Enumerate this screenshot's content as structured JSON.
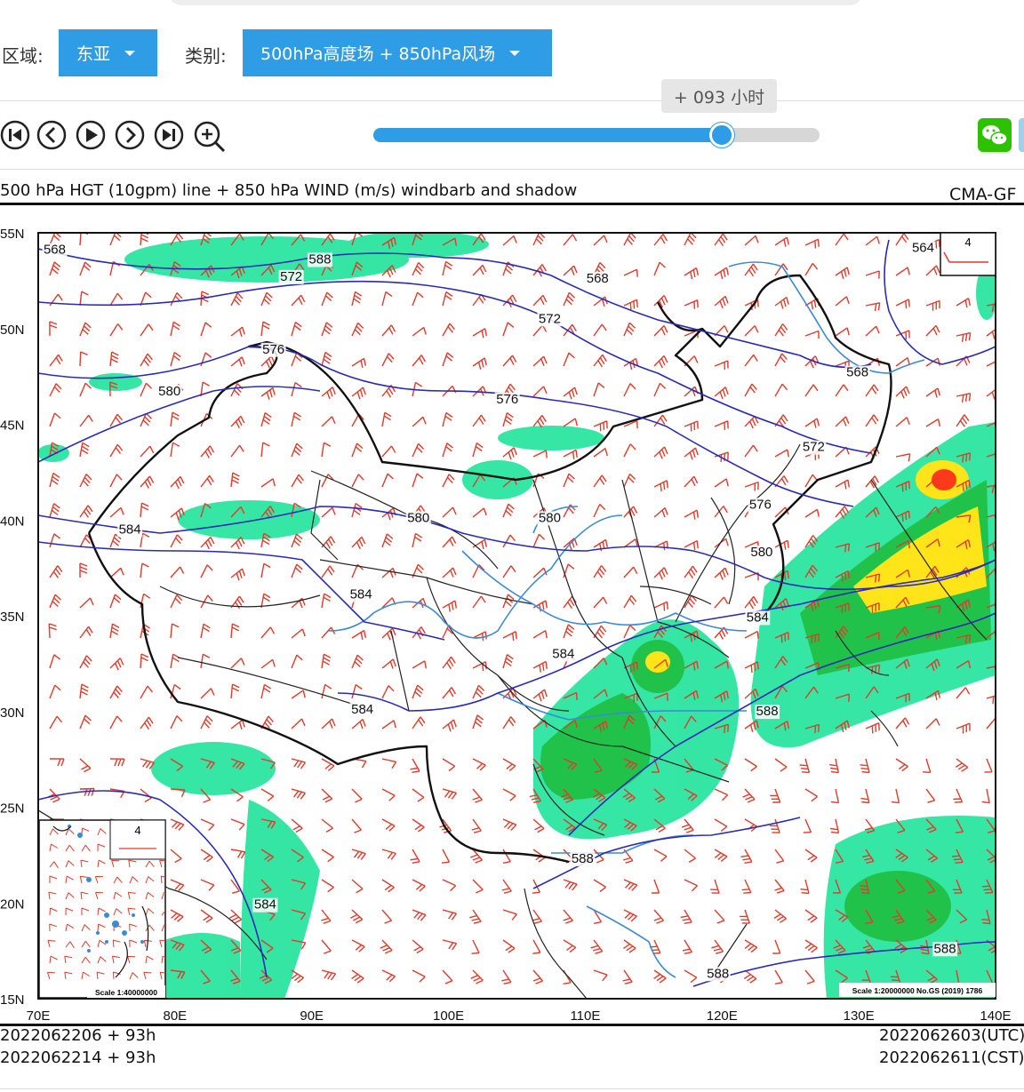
{
  "filters": {
    "region_label": "区域:",
    "region_value": "东亚",
    "category_label": "类别:",
    "category_value": "500hPa高度场 + 850hPa风场"
  },
  "player": {
    "time_tooltip": "+ 093 小时",
    "progress": 0.78,
    "buttons": [
      "first-frame",
      "previous-frame",
      "play",
      "next-frame",
      "last-frame",
      "zoom-in"
    ]
  },
  "map": {
    "title": "500 hPa HGT (10gpm) line + 850 hPa WIND (m/s) windbarb and shadow",
    "source": "CMA-GF",
    "lat_labels": [
      "55N",
      "50N",
      "45N",
      "40N",
      "35N",
      "30N",
      "25N",
      "20N",
      "15N"
    ],
    "lon_labels": [
      "70E",
      "80E",
      "90E",
      "100E",
      "110E",
      "120E",
      "130E",
      "140E"
    ],
    "contour_labels": [
      {
        "text": "568",
        "lon": 71.2,
        "lat": 53.9
      },
      {
        "text": "588",
        "lon": 90.6,
        "lat": 53.4
      },
      {
        "text": "572",
        "lon": 88.5,
        "lat": 52.5
      },
      {
        "text": "568",
        "lon": 110.9,
        "lat": 52.4
      },
      {
        "text": "564",
        "lon": 134.7,
        "lat": 54.0
      },
      {
        "text": "572",
        "lon": 107.4,
        "lat": 50.3
      },
      {
        "text": "576",
        "lon": 87.2,
        "lat": 48.7
      },
      {
        "text": "568",
        "lon": 129.9,
        "lat": 47.5
      },
      {
        "text": "580",
        "lon": 79.6,
        "lat": 46.5
      },
      {
        "text": "576",
        "lon": 104.3,
        "lat": 46.1
      },
      {
        "text": "572",
        "lon": 126.7,
        "lat": 43.6
      },
      {
        "text": "576",
        "lon": 122.8,
        "lat": 40.6
      },
      {
        "text": "580",
        "lon": 97.8,
        "lat": 39.9
      },
      {
        "text": "580",
        "lon": 107.4,
        "lat": 39.9
      },
      {
        "text": "580",
        "lon": 122.9,
        "lat": 38.1
      },
      {
        "text": "584",
        "lon": 76.7,
        "lat": 39.3
      },
      {
        "text": "584",
        "lon": 93.6,
        "lat": 35.9
      },
      {
        "text": "584",
        "lon": 122.6,
        "lat": 34.7
      },
      {
        "text": "584",
        "lon": 108.4,
        "lat": 32.8
      },
      {
        "text": "588",
        "lon": 123.3,
        "lat": 29.8
      },
      {
        "text": "584",
        "lon": 93.7,
        "lat": 29.9
      },
      {
        "text": "588",
        "lon": 109.8,
        "lat": 22.1
      },
      {
        "text": "584",
        "lon": 86.6,
        "lat": 19.7
      },
      {
        "text": "588",
        "lon": 136.3,
        "lat": 17.4
      },
      {
        "text": "588",
        "lon": 119.7,
        "lat": 16.1
      }
    ],
    "legend_box_label": "4",
    "inset_legend_label": "4",
    "inset_scale": "Scale 1:40000000",
    "map_scale": "Scale 1:20000000 No.GS (2019) 1786",
    "colors": {
      "wind_barb": "#e23a2a",
      "contour": "#2a2ab8",
      "river": "#3a8ad8",
      "border": "#111111",
      "shade_low": "#1fe39a",
      "shade_mid": "#21c24a",
      "shade_high": "#ffe41a",
      "shade_max": "#ff3a1a"
    }
  },
  "footer": {
    "init_utc": "2022062206 + 93h",
    "init_cst": "2022062214 + 93h",
    "valid_utc": "2022062603(UTC)",
    "valid_cst": "2022062611(CST)"
  }
}
